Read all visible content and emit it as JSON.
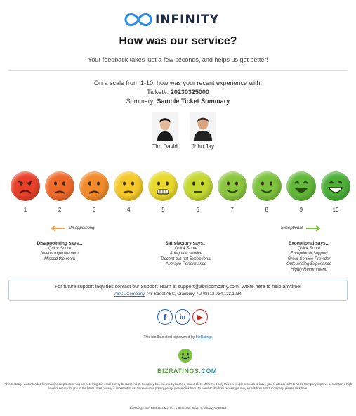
{
  "brand": {
    "name_pre": "",
    "name_accent": "INFIN",
    "name_i": "I",
    "name_post": "TY",
    "full_name": "INFINITY",
    "accent_color": "#2b8be6"
  },
  "header": {
    "title": "How was our service?",
    "subtitle": "Your feedback takes just a few seconds, and helps us get better!"
  },
  "question": {
    "line1": "On a scale from 1-10, how was your recent experience with:",
    "ticket_label": "Ticket#: ",
    "ticket_value": "20230325000",
    "summary_label": "Summary: ",
    "summary_value": "Sample Ticket Summary"
  },
  "agents": [
    {
      "name": "Tim David",
      "icon": "agent-photo"
    },
    {
      "name": "John Jay",
      "icon": "agent-photo"
    }
  ],
  "rating_scale": [
    {
      "value": "1",
      "color": "#e8402a",
      "mood": "angry"
    },
    {
      "value": "2",
      "color": "#ee6a2a",
      "mood": "sad"
    },
    {
      "value": "3",
      "color": "#f08a2a",
      "mood": "sad"
    },
    {
      "value": "4",
      "color": "#f5c829",
      "mood": "meh"
    },
    {
      "value": "5",
      "color": "#e9d92c",
      "mood": "grimace"
    },
    {
      "value": "6",
      "color": "#c5d832",
      "mood": "neutral"
    },
    {
      "value": "7",
      "color": "#8cc63f",
      "mood": "smile"
    },
    {
      "value": "8",
      "color": "#7cc23e",
      "mood": "smile"
    },
    {
      "value": "9",
      "color": "#62b83a",
      "mood": "happy"
    },
    {
      "value": "10",
      "color": "#4caf3a",
      "mood": "grin"
    }
  ],
  "legend": {
    "left": "Disappointing",
    "right": "Exceptional",
    "left_arrow_color": "#f0a050",
    "right_arrow_color": "#7ac143"
  },
  "says": [
    {
      "title": "Disappointing says...",
      "lines": [
        "Quick Score",
        "Needs Improvement",
        "Missed the mark"
      ]
    },
    {
      "title": "Satisfactory says...",
      "lines": [
        "Quick Score",
        "Adequate service",
        "Decent but not Exceptional",
        "Average Performance"
      ]
    },
    {
      "title": "Exceptional says...",
      "lines": [
        "Quick Score",
        "Exceptional Support",
        "Great Service Provider",
        "Outstanding Experience",
        "Highly Recommend"
      ]
    }
  ],
  "support": {
    "line1": "For future support inquiries contact our Support Team at support@abclcompany.com. We're here to help anytime!",
    "company_link": "ABCL Company",
    "address": " 748 Street ABC, Cranbury, NJ 08512 734.123.1234"
  },
  "social": [
    {
      "name": "facebook",
      "glyph": "f"
    },
    {
      "name": "linkedin",
      "glyph": "in"
    },
    {
      "name": "youtube",
      "glyph": "▶"
    }
  ],
  "powered": {
    "text": "This feedback tool is powered by ",
    "link": "BizRatings"
  },
  "bizratings": {
    "name": "BIZRATINGS",
    "com": ".COM"
  },
  "disclaimer": "This message was intended for email@example.com. You are receiving this email survey because ABCL Company has indicated you are a valued client of theirs. It only takes a couple seconds to leave your feedback to help ABCL Company improve or maintain a high level of service for you in the future. Your privacy is important to us. To review our privacy policy, please click here. To unsubscribe from receiving survey emails from ABCL Company, please click here.",
  "footer": "BizRatings.com 560Score Me, Inc. 1 Corporate Drive, Cranbury, NJ 08512"
}
